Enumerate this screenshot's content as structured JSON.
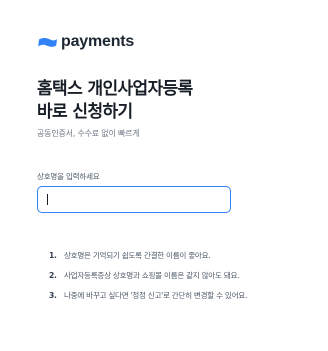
{
  "brand": {
    "name": "payments",
    "icon": "toss-wave-logo",
    "color": "#3182f6"
  },
  "header": {
    "title_line1": "홈택스 개인사업자등록",
    "title_line2": "바로 신청하기",
    "subtitle": "공동인증서, 수수료 없이 빠르게"
  },
  "form": {
    "label": "상호명을 입력하세요",
    "input_value": ""
  },
  "tips": [
    {
      "num": "1.",
      "text": "상호명은 기억되기 쉽도록 간결한 이름이 좋아요."
    },
    {
      "num": "2.",
      "text": "사업자등록증상 상호명과 쇼핑몰 이름은 같지 않아도 돼요."
    },
    {
      "num": "3.",
      "text": "나중에 바꾸고 싶다면 '정정 신고'로 간단히 변경할 수 있어요."
    }
  ]
}
